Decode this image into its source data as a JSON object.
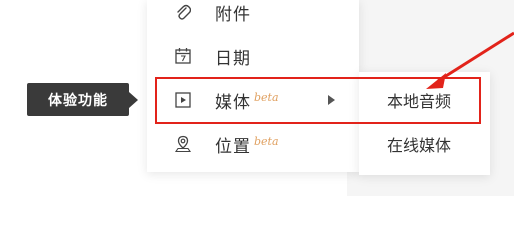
{
  "tooltip": {
    "label": "体验功能"
  },
  "menu": {
    "items": [
      {
        "label": "附件",
        "icon": "paperclip-icon",
        "beta": ""
      },
      {
        "label": "日期",
        "icon": "calendar-icon",
        "beta": ""
      },
      {
        "label": "媒体",
        "icon": "media-play-icon",
        "beta": "beta"
      },
      {
        "label": "位置",
        "icon": "location-pin-icon",
        "beta": "beta"
      }
    ]
  },
  "submenu": {
    "items": [
      {
        "label": "本地音频"
      },
      {
        "label": "在线媒体"
      }
    ]
  },
  "colors": {
    "highlight": "#e2231a",
    "tooltip_bg": "#3a3a3a",
    "beta": "#e0a060"
  }
}
